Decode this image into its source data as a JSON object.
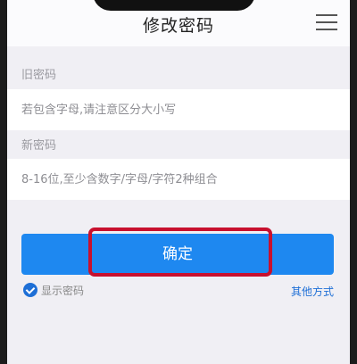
{
  "header": {
    "title": "修改密码",
    "menu_icon": "hamburger-menu-icon"
  },
  "form": {
    "old_password_label": "旧密码",
    "old_password_placeholder": "若包含字母,请注意区分大小写",
    "new_password_label": "新密码",
    "new_password_placeholder": "8-16位,至少含数字/字母/字符2种组合"
  },
  "actions": {
    "confirm_label": "确定",
    "show_password_label": "显示密码",
    "show_password_checked": true,
    "other_methods_label": "其他方式"
  },
  "colors": {
    "accent": "#1e88f0",
    "highlight": "#c8102e",
    "link": "#1e6fd6",
    "background": "#f0eff4"
  }
}
